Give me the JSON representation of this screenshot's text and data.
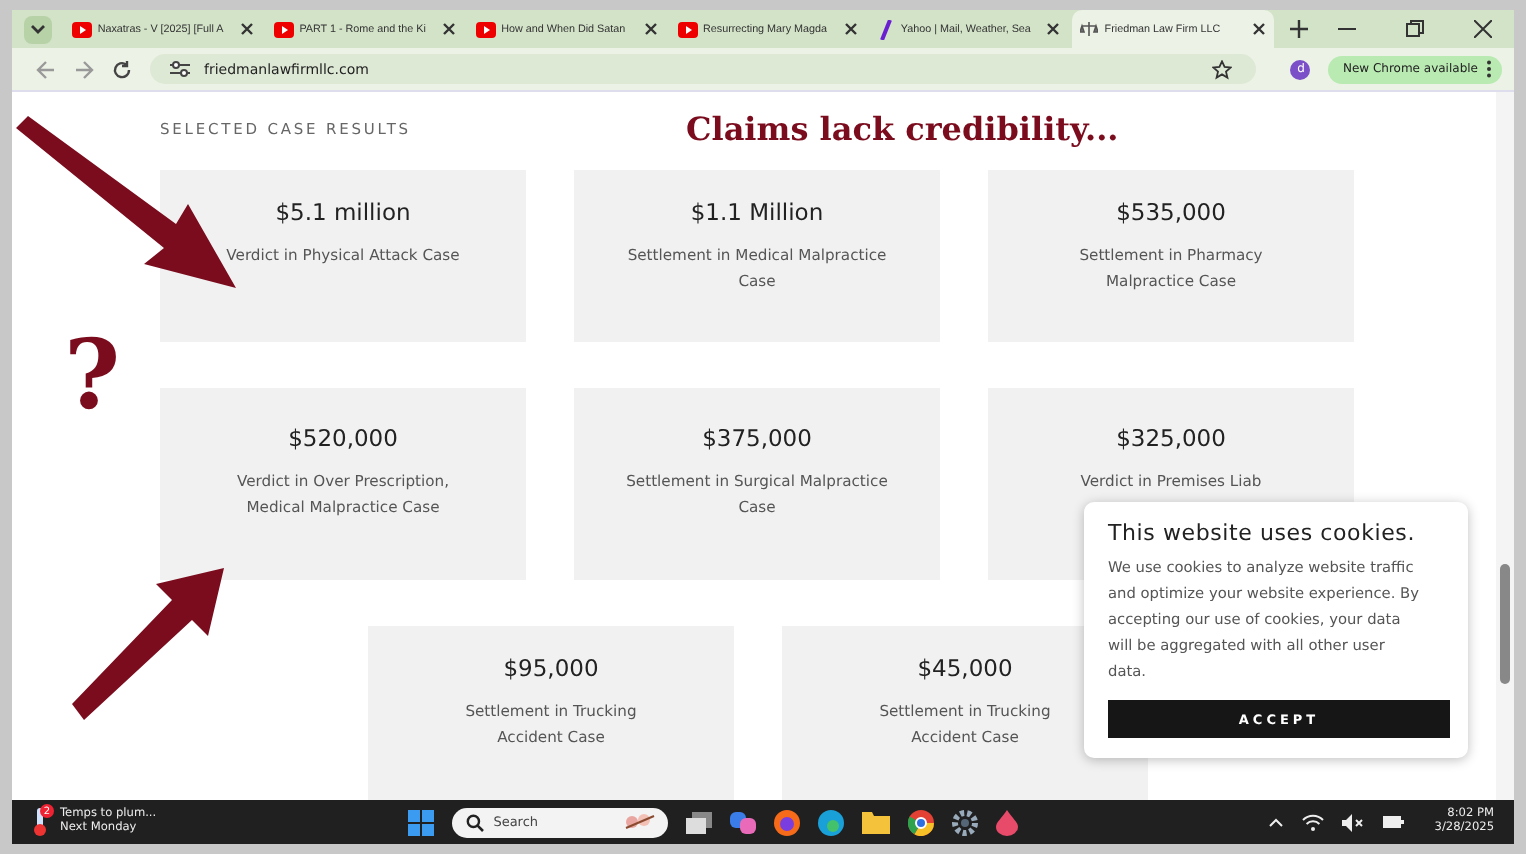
{
  "browser": {
    "tabs": [
      {
        "title": "Naxatras - V [2025] [Full A",
        "kind": "video",
        "selected": false
      },
      {
        "title": "PART 1 - Rome and the Ki",
        "kind": "video",
        "selected": false
      },
      {
        "title": "How and When Did Satan",
        "kind": "video",
        "selected": false
      },
      {
        "title": "Resurrecting Mary Magda",
        "kind": "video",
        "selected": false
      },
      {
        "title": "Yahoo | Mail, Weather, Sea",
        "kind": "mail",
        "selected": false
      },
      {
        "title": "Friedman Law Firm LLC",
        "kind": "site",
        "selected": true
      }
    ],
    "url": "friedmanlawfirmllc.com",
    "profile": "d",
    "update_button": "New Chrome available"
  },
  "page": {
    "section_title": "SELECTED CASE RESULTS",
    "annotation": "Claims lack credibility...",
    "annotation_mark": "?",
    "rows": [
      [
        {
          "amount": "$5.1 million",
          "description": "Verdict in Physical Attack Case"
        },
        {
          "amount": "$1.1 Million",
          "description": "Settlement in Medical Malpractice Case"
        },
        {
          "amount": "$535,000",
          "description": "Settlement in Pharmacy Malpractice Case"
        }
      ],
      [
        {
          "amount": "$520,000",
          "description": "Verdict in Over Prescription, Medical Malpractice Case"
        },
        {
          "amount": "$375,000",
          "description": "Settlement in Surgical Malpractice Case"
        },
        {
          "amount": "$325,000",
          "description": "Verdict in Premises Liab"
        }
      ],
      [
        {
          "amount": "$95,000",
          "description": "Settlement in Trucking Accident Case"
        },
        {
          "amount": "$45,000",
          "description": "Settlement in Trucking Accident Case"
        }
      ]
    ]
  },
  "cookie_banner": {
    "title": "This website uses cookies.",
    "text": "We use cookies to analyze website traffic and optimize your website experience. By accepting our use of cookies, your data will be aggregated with all other user data.",
    "button": "ACCEPT"
  },
  "taskbar": {
    "weather_badge": "2",
    "weather_title": "Temps to plum...",
    "weather_subtitle": "Next Monday",
    "search_placeholder": "Search",
    "time": "8:02 PM",
    "date": "3/28/2025"
  }
}
